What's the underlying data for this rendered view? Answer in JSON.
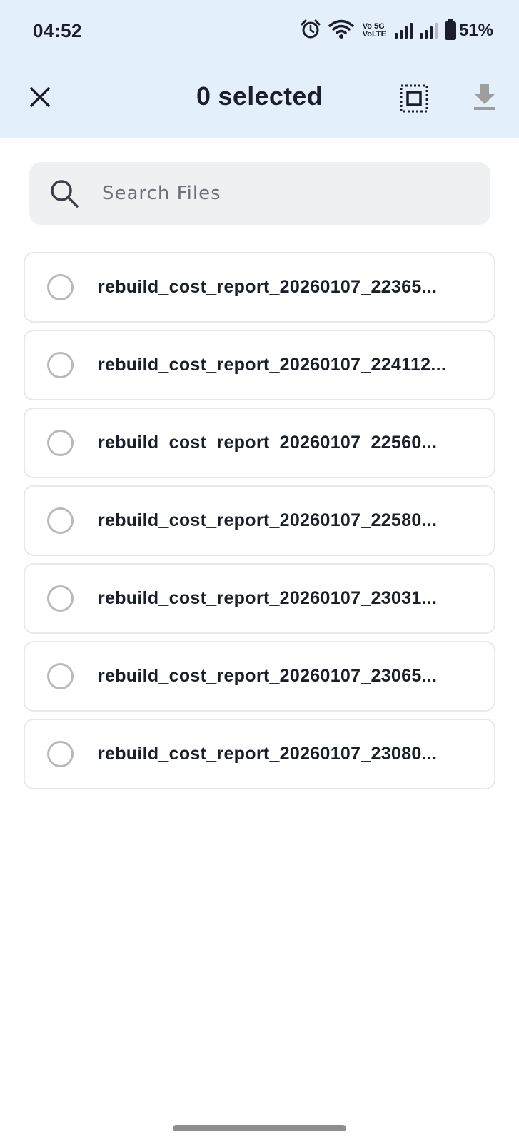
{
  "status_bar": {
    "time": "04:52",
    "volte_top": "Vo 5G",
    "volte_bottom": "VoLTE",
    "battery": "51%",
    "icons": [
      "alarm-icon",
      "wifi-icon",
      "volte-icon",
      "signal-icon",
      "signal-icon-2",
      "battery-icon"
    ]
  },
  "appbar": {
    "close_icon": "close-icon",
    "title": "0 selected",
    "select_all_icon": "select-all-icon",
    "download_icon": "download-icon"
  },
  "search": {
    "placeholder": "Search Files",
    "value": ""
  },
  "files": [
    {
      "name": "rebuild_cost_report_20260107_22365..."
    },
    {
      "name": "rebuild_cost_report_20260107_224112..."
    },
    {
      "name": "rebuild_cost_report_20260107_22560..."
    },
    {
      "name": "rebuild_cost_report_20260107_22580..."
    },
    {
      "name": "rebuild_cost_report_20260107_23031..."
    },
    {
      "name": "rebuild_cost_report_20260107_23065..."
    },
    {
      "name": "rebuild_cost_report_20260107_23080..."
    }
  ],
  "colors": {
    "header_bg": "#e3effb",
    "text": "#1a1f2b",
    "radio_border": "#b9b9b9",
    "search_bg": "#eff0f2",
    "download_disabled": "#9e9e9e"
  }
}
